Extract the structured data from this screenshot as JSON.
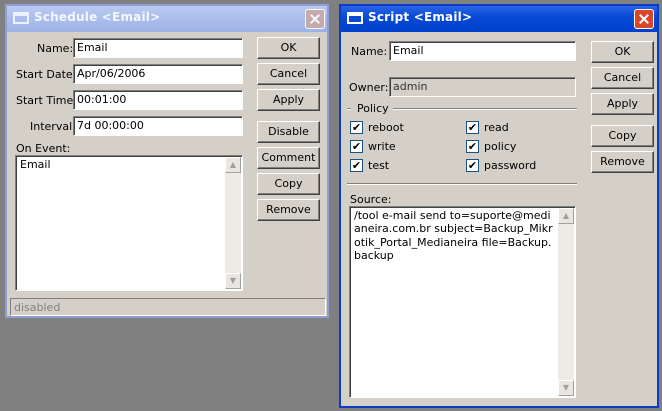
{
  "schedule": {
    "title": "Schedule <Email>",
    "fields": {
      "name_label": "Name:",
      "name_value": "Email",
      "start_date_label": "Start Date:",
      "start_date_value": "Apr/06/2006",
      "start_time_label": "Start Time:",
      "start_time_value": "00:01:00",
      "interval_label": "Interval:",
      "interval_value": "7d 00:00:00",
      "on_event_label": "On Event:",
      "on_event_value": "Email"
    },
    "buttons": {
      "ok": "OK",
      "cancel": "Cancel",
      "apply": "Apply",
      "disable": "Disable",
      "comment": "Comment",
      "copy": "Copy",
      "remove": "Remove"
    },
    "status": "disabled"
  },
  "script": {
    "title": "Script <Email>",
    "fields": {
      "name_label": "Name:",
      "name_value": "Email",
      "owner_label": "Owner:",
      "owner_value": "admin",
      "policy_label": "Policy",
      "source_label": "Source:",
      "source_value": "/tool e-mail send to=suporte@medianeira.com.br subject=Backup_Mikrotik_Portal_Medianeira file=Backup.backup"
    },
    "policies": [
      {
        "label": "reboot",
        "checked": true
      },
      {
        "label": "read",
        "checked": true
      },
      {
        "label": "write",
        "checked": true
      },
      {
        "label": "policy",
        "checked": true
      },
      {
        "label": "test",
        "checked": true
      },
      {
        "label": "password",
        "checked": true
      }
    ],
    "buttons": {
      "ok": "OK",
      "cancel": "Cancel",
      "apply": "Apply",
      "copy": "Copy",
      "remove": "Remove"
    }
  },
  "icons": {
    "window_icon": "window-icon",
    "close_icon": "close-icon",
    "check_mark": "✔"
  }
}
